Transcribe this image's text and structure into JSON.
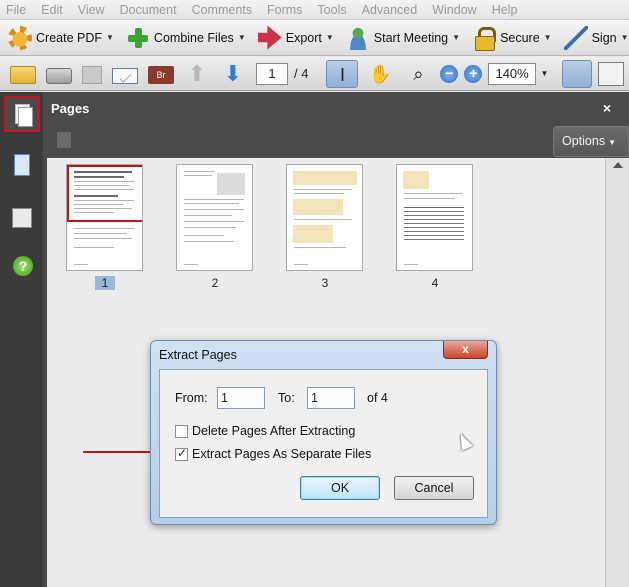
{
  "menu": [
    "File",
    "Edit",
    "View",
    "Document",
    "Comments",
    "Forms",
    "Tools",
    "Advanced",
    "Window",
    "Help"
  ],
  "tasks": [
    {
      "label": "Create PDF",
      "icon": "create-pdf-icon"
    },
    {
      "label": "Combine Files",
      "icon": "combine-files-icon"
    },
    {
      "label": "Export",
      "icon": "export-icon"
    },
    {
      "label": "Start Meeting",
      "icon": "meeting-icon"
    },
    {
      "label": "Secure",
      "icon": "lock-icon"
    },
    {
      "label": "Sign",
      "icon": "pen-icon"
    }
  ],
  "toolbar": {
    "page_current": "1",
    "page_total": "/ 4",
    "zoom": "140%",
    "review_badge": "Br",
    "zoom_out": "−",
    "zoom_in": "+"
  },
  "panel": {
    "title": "Pages",
    "close": "×",
    "options_label": "Options",
    "thumbnails": [
      {
        "label": "1",
        "selected": true
      },
      {
        "label": "2",
        "selected": false
      },
      {
        "label": "3",
        "selected": false
      },
      {
        "label": "4",
        "selected": false
      }
    ]
  },
  "nav": {
    "help_glyph": "?"
  },
  "dialog": {
    "title": "Extract Pages",
    "close_glyph": "x",
    "from_label": "From:",
    "from_value": "1",
    "to_label": "To:",
    "to_value": "1",
    "of_label": "of 4",
    "option_delete": {
      "label": "Delete Pages After Extracting",
      "checked": false
    },
    "option_separate": {
      "label": "Extract Pages As Separate Files",
      "checked": true
    },
    "ok_label": "OK",
    "cancel_label": "Cancel"
  },
  "colors": {
    "annotation_red": "#c4121a",
    "panel_dark": "#4a4a4a",
    "dialog_frame": "#b7cfe9"
  }
}
